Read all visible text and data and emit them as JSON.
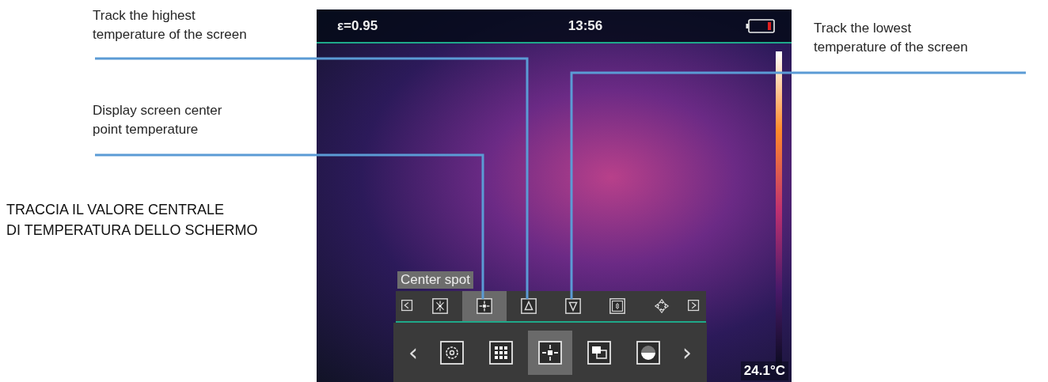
{
  "annotations": [
    {
      "lines": [
        "Track the highest",
        "temperature of the screen"
      ]
    },
    {
      "lines": [
        "Display screen center",
        "point temperature"
      ]
    },
    {
      "lines": [
        "Track the lowest",
        "temperature of the screen"
      ]
    }
  ],
  "note": [
    "TRACCIA IL VALORE CENTRALE",
    "DI TEMPERATURA DELLO SCHERMO"
  ],
  "status_bar": {
    "emissivity": "ε=0.95",
    "time": "13:56"
  },
  "tooltip": "Center spot",
  "measure_tools": [
    {
      "kind": "prev",
      "selected": false
    },
    {
      "kind": "cross",
      "selected": false
    },
    {
      "kind": "center",
      "selected": true
    },
    {
      "kind": "max",
      "selected": false
    },
    {
      "kind": "min",
      "selected": false
    },
    {
      "kind": "area",
      "selected": false
    },
    {
      "kind": "move",
      "selected": false
    },
    {
      "kind": "next",
      "selected": false
    }
  ],
  "menu_prev": "‹",
  "menu": [
    {
      "kind": "settings",
      "selected": false
    },
    {
      "kind": "grid",
      "selected": false
    },
    {
      "kind": "center",
      "selected": true
    },
    {
      "kind": "overlap",
      "selected": false
    },
    {
      "kind": "palette",
      "selected": false
    }
  ],
  "menu_next": "›",
  "reading": "24.1°C"
}
